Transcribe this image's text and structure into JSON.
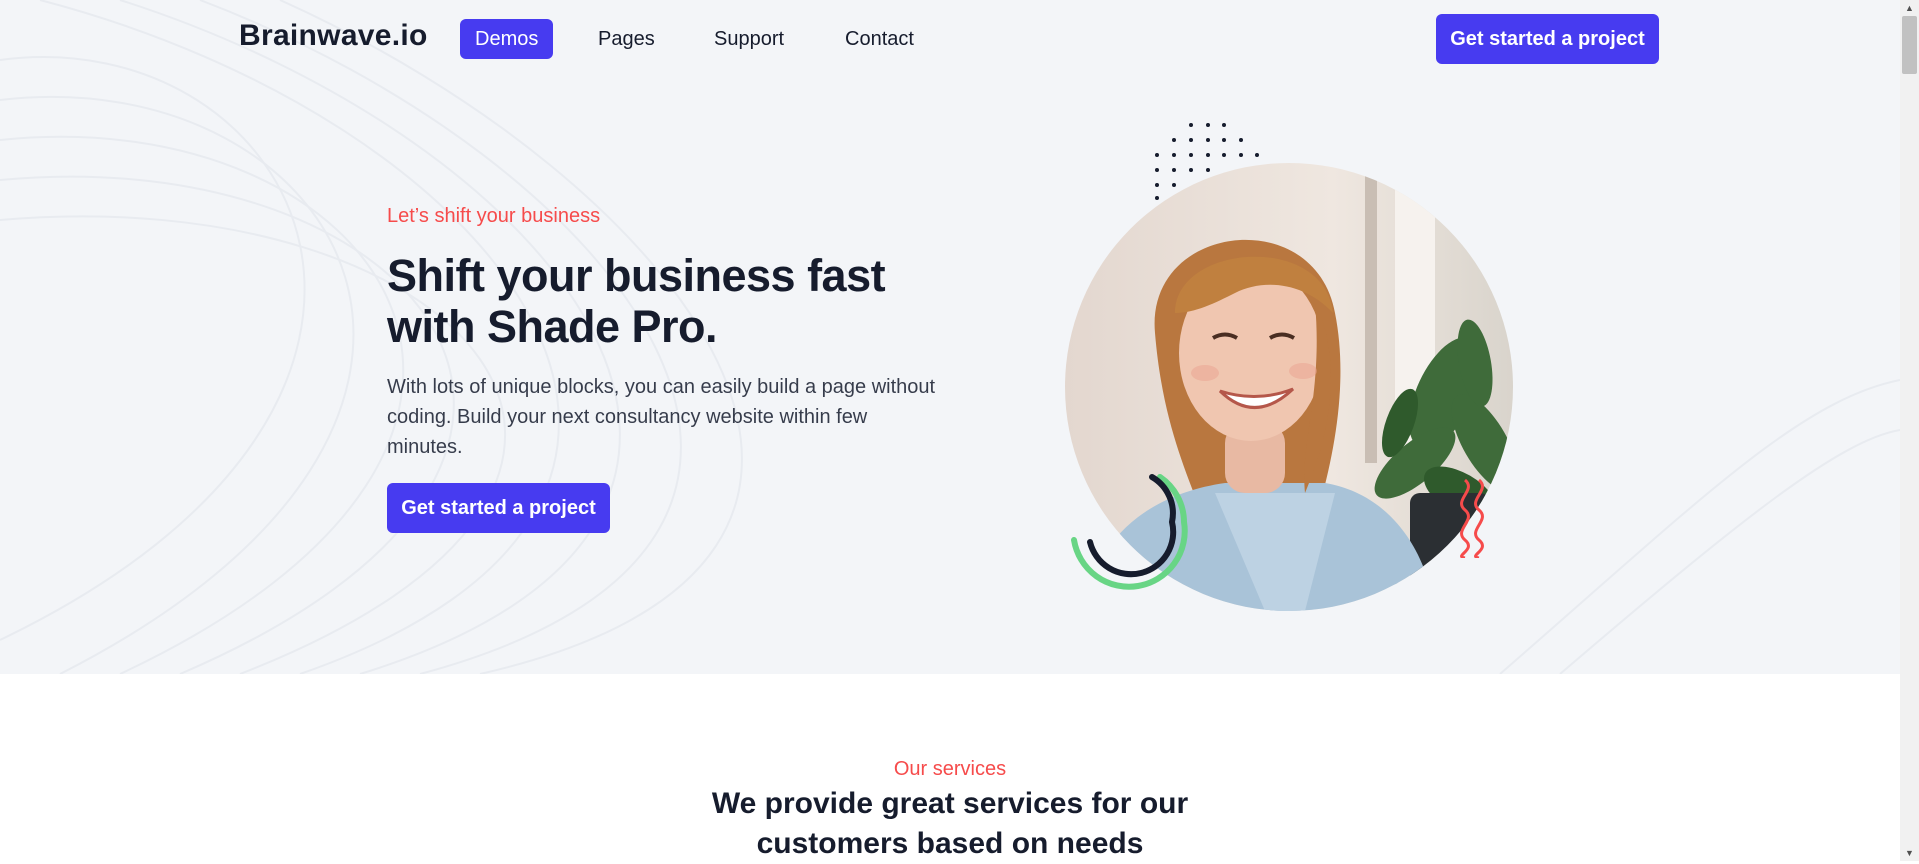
{
  "nav": {
    "brand": "Brainwave.io",
    "items": [
      {
        "label": "Demos",
        "active": true
      },
      {
        "label": "Pages",
        "active": false
      },
      {
        "label": "Support",
        "active": false
      },
      {
        "label": "Contact",
        "active": false
      }
    ],
    "cta_label": "Get started a project"
  },
  "hero": {
    "eyebrow": "Let’s shift your business",
    "title": "Shift your business fast with Shade Pro.",
    "description": "With lots of unique blocks, you can easily build a page without coding. Build your next consultancy website within few minutes.",
    "cta_label": "Get started a project",
    "image_subject": "smiling-woman-photo"
  },
  "services": {
    "eyebrow": "Our services",
    "title_line1": "We provide great services for our",
    "title_line2": "customers based on needs"
  },
  "colors": {
    "accent": "#473bf0",
    "highlight": "#f64b4b",
    "green": "#68d585",
    "dark": "#161c2d",
    "hero_bg": "#f3f5f8"
  },
  "icons": {
    "scroll_up": "▲",
    "scroll_down": "▼"
  }
}
